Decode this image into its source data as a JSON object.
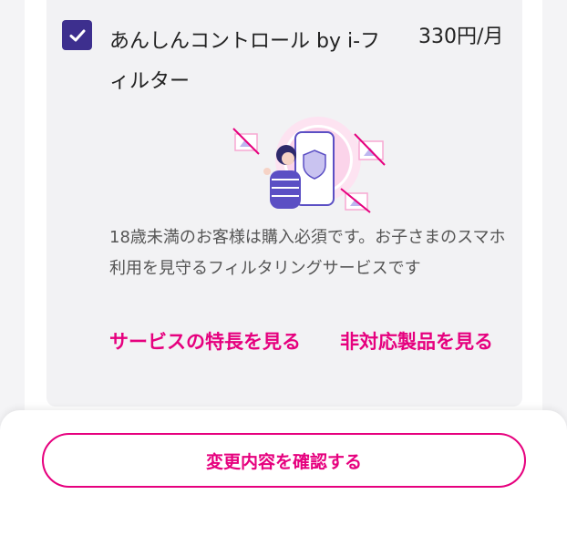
{
  "option": {
    "checked": true,
    "title": "あんしんコントロール by i-フィルター",
    "price": "330円/月",
    "description": "18歳未満のお客様は購入必須です。お子さまのスマホ利用を見守るフィルタリングサービスです",
    "links": {
      "features": "サービスの特長を見る",
      "unsupported": "非対応製品を見る"
    },
    "illustration_icon": "child-smartphone-filter-icon"
  },
  "footer": {
    "confirm_label": "変更内容を確認する"
  },
  "colors": {
    "accent": "#e6007e",
    "checkbox": "#3d2f8e",
    "card_background": "#f2f2f4"
  }
}
